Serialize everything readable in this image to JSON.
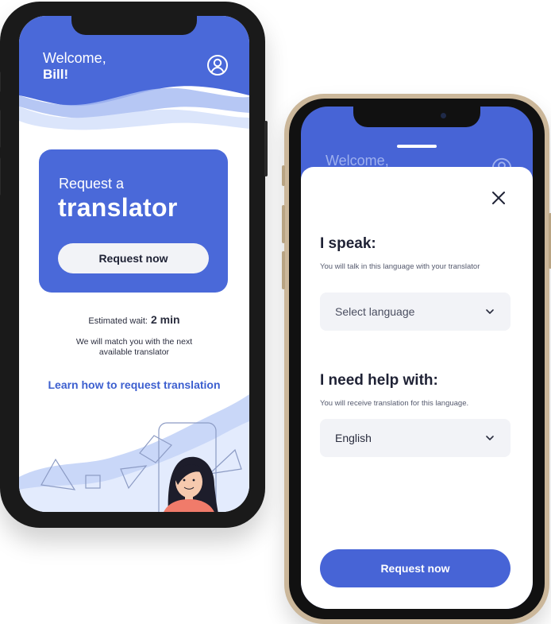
{
  "home_screen": {
    "welcome": "Welcome,",
    "user_name": "Bill!",
    "profile_icon": "user-circle-icon",
    "card": {
      "pre_title": "Request a",
      "title": "translator",
      "button_label": "Request now"
    },
    "estimated_wait_label": "Estimated wait:",
    "estimated_wait_value": "2 min",
    "match_text": "We will match you with the next available translator",
    "learn_link": "Learn how to request translation"
  },
  "request_sheet": {
    "background_welcome": "Welcome,",
    "close_icon": "close-icon",
    "speak_heading": "I speak:",
    "speak_sub": "You will talk in this language with your translator",
    "speak_select": "Select language",
    "help_heading": "I need help with:",
    "help_sub": "You will receive translation for this language.",
    "help_select": "English",
    "submit_label": "Request now"
  },
  "colors": {
    "brand_blue": "#4a69d9",
    "light_wave": "#c9d7f8",
    "button_light": "#f2f3f7",
    "text_dark": "#1f2235"
  }
}
